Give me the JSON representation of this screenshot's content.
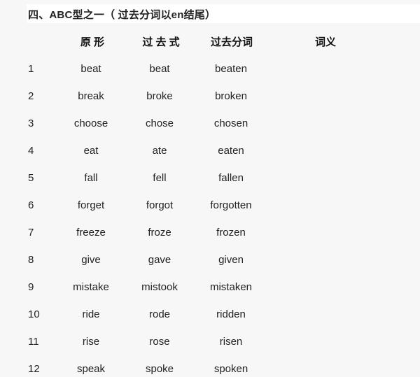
{
  "title": "四、ABC型之一（ 过去分词以en结尾）",
  "header": {
    "base": "原 形",
    "past": "过 去 式",
    "past_participle": "过去分词",
    "meaning": "词义"
  },
  "rows": [
    {
      "num": "1",
      "base": "beat",
      "past": "beat",
      "pp": "beaten"
    },
    {
      "num": "2",
      "base": "break",
      "past": "broke",
      "pp": "broken"
    },
    {
      "num": "3",
      "base": "choose",
      "past": "chose",
      "pp": "chosen"
    },
    {
      "num": "4",
      "base": "eat",
      "past": "ate",
      "pp": "eaten"
    },
    {
      "num": "5",
      "base": "fall",
      "past": "fell",
      "pp": "fallen"
    },
    {
      "num": "6",
      "base": "forget",
      "past": "forgot",
      "pp": "forgotten"
    },
    {
      "num": "7",
      "base": "freeze",
      "past": "froze",
      "pp": "frozen"
    },
    {
      "num": "8",
      "base": "give",
      "past": "gave",
      "pp": "given"
    },
    {
      "num": "9",
      "base": "mistake",
      "past": "mistook",
      "pp": "mistaken"
    },
    {
      "num": "10",
      "base": "ride",
      "past": "rode",
      "pp": "ridden"
    },
    {
      "num": "11",
      "base": "rise",
      "past": "rose",
      "pp": "risen"
    },
    {
      "num": "12",
      "base": "speak",
      "past": "spoke",
      "pp": "spoken"
    }
  ]
}
